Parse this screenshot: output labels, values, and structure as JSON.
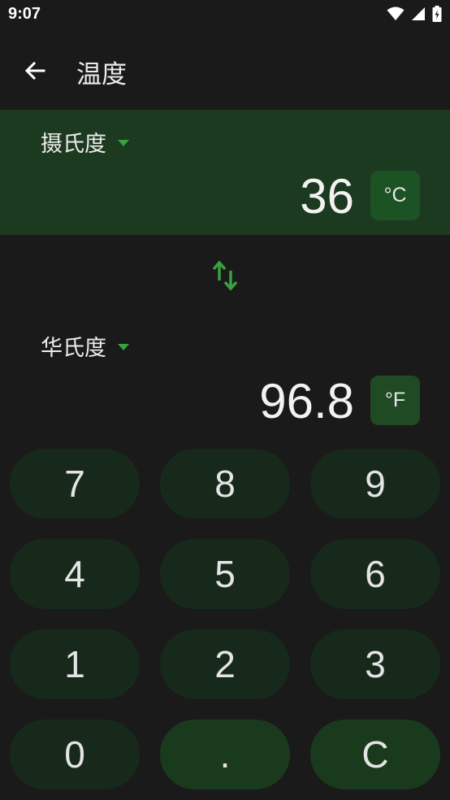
{
  "status_bar": {
    "time": "9:07"
  },
  "app_bar": {
    "title": "温度"
  },
  "from": {
    "unit_name": "摄氏度",
    "value": "36",
    "unit_symbol": "°C"
  },
  "to": {
    "unit_name": "华氏度",
    "value": "96.8",
    "unit_symbol": "°F"
  },
  "keypad": {
    "keys": [
      "7",
      "8",
      "9",
      "4",
      "5",
      "6",
      "1",
      "2",
      "3",
      "0",
      ".",
      "C"
    ]
  },
  "colors": {
    "background": "#1a1a1a",
    "accent": "#3aa13f",
    "panel": "#1c3a20",
    "key": "#17291a"
  },
  "icons": {
    "back": "arrow-left-icon",
    "swap": "swap-vertical-icon",
    "wifi": "wifi-icon",
    "signal": "signal-icon",
    "battery": "battery-icon"
  }
}
